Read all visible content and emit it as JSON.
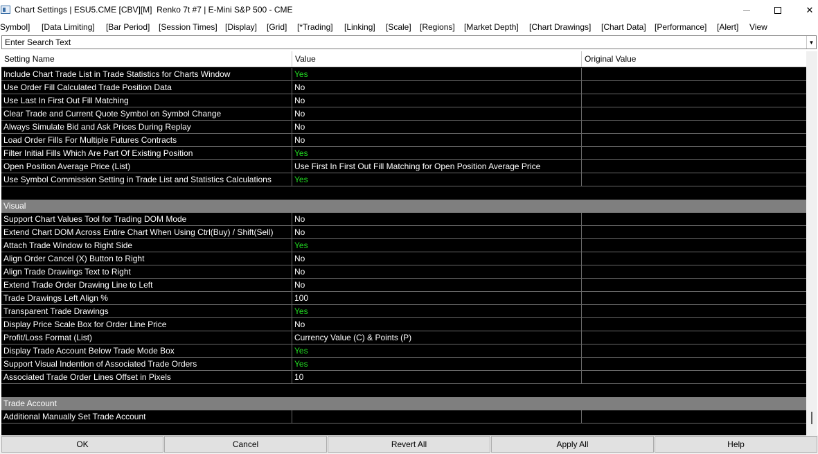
{
  "window": {
    "title": "Chart Settings | ESU5.CME [CBV][M]  Renko 7t #7 | E-Mini S&P 500 - CME"
  },
  "tabs": [
    "Symbol]",
    "[Data Limiting]",
    "[Bar Period]",
    "[Session Times]",
    "[Display]",
    "[Grid]",
    "[*Trading]",
    "[Linking]",
    "[Scale]",
    "[Regions]",
    "[Market Depth]",
    "[Chart Drawings]",
    "[Chart Data]",
    "[Performance]",
    "[Alert]",
    "View"
  ],
  "search": {
    "placeholder": "Enter Search Text",
    "value": ""
  },
  "columns": {
    "name": "Setting Name",
    "value": "Value",
    "original": "Original Value"
  },
  "rows": [
    {
      "type": "setting",
      "name": "Include Chart Trade List in Trade Statistics for Charts Window",
      "value": "Yes",
      "original": ""
    },
    {
      "type": "setting",
      "name": "Use Order Fill Calculated Trade Position Data",
      "value": "No",
      "original": ""
    },
    {
      "type": "setting",
      "name": "Use Last In First Out Fill Matching",
      "value": "No",
      "original": ""
    },
    {
      "type": "setting",
      "name": "Clear Trade and Current Quote Symbol on Symbol Change",
      "value": "No",
      "original": ""
    },
    {
      "type": "setting",
      "name": "Always Simulate Bid and Ask Prices During Replay",
      "value": "No",
      "original": ""
    },
    {
      "type": "setting",
      "name": "Load Order Fills For Multiple Futures Contracts",
      "value": "No",
      "original": ""
    },
    {
      "type": "setting",
      "name": "Filter Initial Fills Which Are Part Of Existing Position",
      "value": "Yes",
      "original": ""
    },
    {
      "type": "setting",
      "name": "Open Position Average Price (List)",
      "value": "Use First In First Out Fill Matching for Open Position Average Price",
      "original": ""
    },
    {
      "type": "setting",
      "name": "Use Symbol Commission Setting in Trade List and Statistics Calculations",
      "value": "Yes",
      "original": ""
    },
    {
      "type": "blank"
    },
    {
      "type": "section",
      "name": "Visual"
    },
    {
      "type": "setting",
      "name": "Support Chart Values Tool for Trading DOM Mode",
      "value": "No",
      "original": ""
    },
    {
      "type": "setting",
      "name": "Extend Chart DOM Across Entire Chart When Using Ctrl(Buy) / Shift(Sell)",
      "value": "No",
      "original": ""
    },
    {
      "type": "setting",
      "name": "Attach Trade Window to Right Side",
      "value": "Yes",
      "original": ""
    },
    {
      "type": "setting",
      "name": "Align Order Cancel (X) Button to Right",
      "value": "No",
      "original": ""
    },
    {
      "type": "setting",
      "name": "Align Trade Drawings Text to Right",
      "value": "No",
      "original": ""
    },
    {
      "type": "setting",
      "name": "Extend Trade Order Drawing Line to Left",
      "value": "No",
      "original": ""
    },
    {
      "type": "setting",
      "name": "Trade Drawings Left Align %",
      "value": "100",
      "original": ""
    },
    {
      "type": "setting",
      "name": "Transparent Trade Drawings",
      "value": "Yes",
      "original": ""
    },
    {
      "type": "setting",
      "name": "Display Price Scale Box for Order Line Price",
      "value": "No",
      "original": ""
    },
    {
      "type": "setting",
      "name": "Profit/Loss Format (List)",
      "value": "Currency Value (C) & Points (P)",
      "original": ""
    },
    {
      "type": "setting",
      "name": "Display Trade Account Below Trade Mode Box",
      "value": "Yes",
      "original": ""
    },
    {
      "type": "setting",
      "name": "Support Visual Indention of Associated Trade Orders",
      "value": "Yes",
      "original": ""
    },
    {
      "type": "setting",
      "name": "Associated Trade Order Lines Offset in Pixels",
      "value": "10",
      "original": ""
    },
    {
      "type": "blank"
    },
    {
      "type": "section",
      "name": "Trade Account"
    },
    {
      "type": "setting",
      "name": "Additional Manually Set Trade Account",
      "value": "",
      "original": ""
    }
  ],
  "buttons": {
    "ok": "OK",
    "cancel": "Cancel",
    "revert_all": "Revert All",
    "apply_all": "Apply All",
    "help": "Help"
  },
  "colors": {
    "grid_bg": "#000000",
    "grid_text": "#ffffff",
    "yes_text": "#22dd22",
    "section_bg": "#7f7f7f"
  },
  "icons": {
    "app": "chart-settings-app-icon",
    "dropdown": "chevron-down-icon"
  }
}
